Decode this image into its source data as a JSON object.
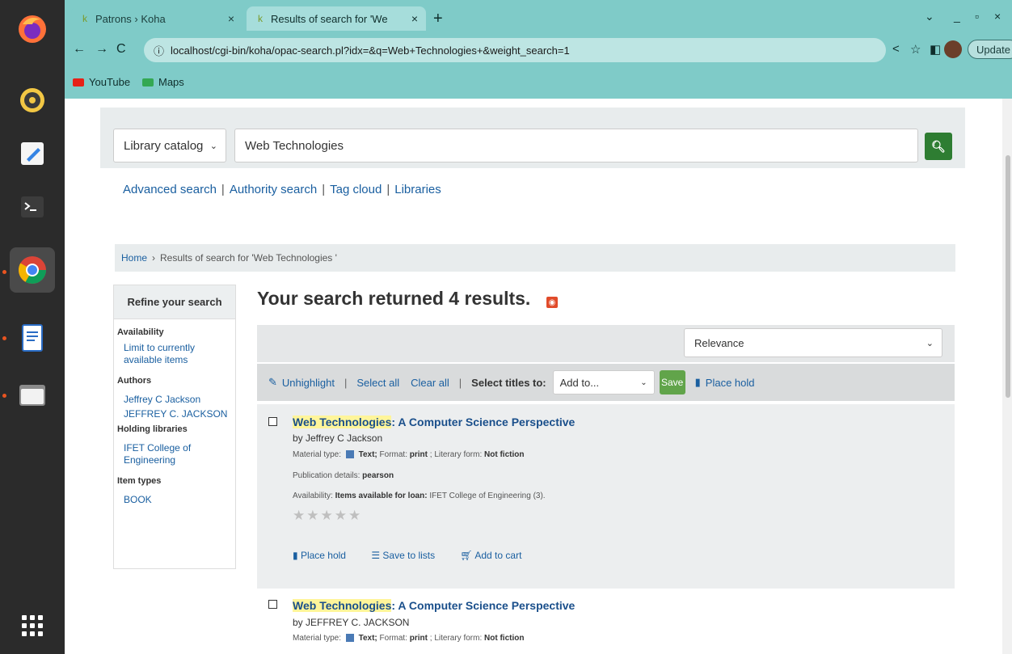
{
  "dock": {
    "apps": [
      "firefox-icon",
      "rhythmbox-icon",
      "text-editor-icon",
      "terminal-icon",
      "chrome-icon",
      "writer-icon",
      "files-icon"
    ],
    "show_apps_icon": "app-grid-icon"
  },
  "browser": {
    "tabs": [
      {
        "label": "Patrons › Koha",
        "close": "×"
      },
      {
        "label": "Results of search for 'We",
        "close": "×"
      }
    ],
    "new_tab": "+",
    "url": "localhost/cgi-bin/koha/opac-search.pl?idx=&q=Web+Technologies+&weight_search=1",
    "update_label": "Update",
    "bookmarks": [
      {
        "label": "YouTube",
        "color": "#e62117"
      },
      {
        "label": "Maps",
        "color": "#34a853"
      }
    ],
    "window_controls": [
      "⌄",
      "_",
      "▫",
      "×"
    ]
  },
  "opac": {
    "catalog_select": "Library catalog",
    "search_value": "Web Technologies",
    "search_icon": "search-icon",
    "quick_links": [
      "Advanced search",
      "Authority search",
      "Tag cloud",
      "Libraries"
    ],
    "breadcrumb": {
      "home": "Home",
      "current": "Results of search for 'Web Technologies '"
    },
    "results_heading": "Your search returned 4 results.",
    "sort_value": "Relevance",
    "toolbar": {
      "unhighlight": "Unhighlight",
      "select_all": "Select all",
      "clear_all": "Clear all",
      "select_titles": "Select titles to:",
      "add_to": "Add to...",
      "save": "Save",
      "place_hold": "Place hold"
    },
    "facets": {
      "heading": "Refine your search",
      "availability_title": "Availability",
      "availability_link": "Limit to currently available items",
      "authors_title": "Authors",
      "authors": [
        "Jeffrey C Jackson",
        "JEFFREY C. JACKSON"
      ],
      "holding_title": "Holding libraries",
      "holding": "IFET College of Engineering",
      "itemtypes_title": "Item types",
      "itemtype": "BOOK"
    },
    "results": [
      {
        "title_highlight": "Web Technologies",
        "title_rest": ": A Computer Science Perspective",
        "author": "by Jeffrey C Jackson",
        "material_label": "Material type:",
        "material_text": "Text;",
        "format_label": "Format:",
        "format_value": "print",
        "literary_label": "; Literary form:",
        "literary_value": "Not fiction",
        "publication_label": "Publication details:",
        "publication_value": "pearson",
        "availability_label": "Availability:",
        "availability_bold": "Items available for loan:",
        "availability_value": "IFET College of Engineering (3).",
        "rating": 0,
        "actions": [
          "Place hold",
          "Save to lists",
          "Add to cart"
        ]
      },
      {
        "title_highlight": "Web Technologies",
        "title_rest": ": A Computer Science Perspective",
        "author": "by JEFFREY C. JACKSON",
        "material_label": "Material type:",
        "material_text": "Text;",
        "format_label": "Format:",
        "format_value": "print",
        "literary_label": "; Literary form:",
        "literary_value": "Not fiction"
      }
    ]
  }
}
